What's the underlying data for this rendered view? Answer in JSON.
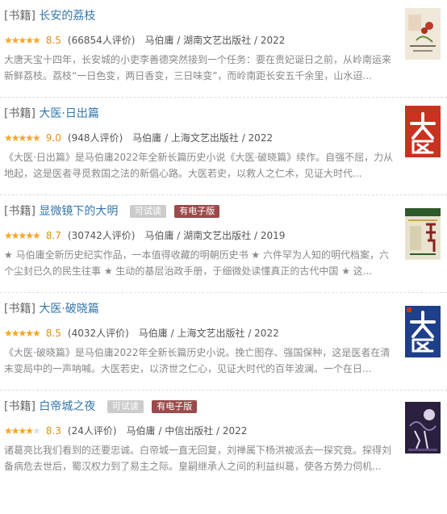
{
  "books": [
    {
      "category": "[书籍]",
      "title": "长安的荔枝",
      "tags": [],
      "score": "8.5",
      "rating_count": "(66854人评价)",
      "stars_filled": 4.5,
      "author": "马伯庸",
      "publisher": "湖南文艺出版社",
      "year": "2022",
      "description": "大唐天宝十四年，长安城的小吏李善德突然接到一个任务：要在贵妃诞日之前，从岭南运来新鲜荔枝。荔枝“一日色变，两日香变，三日味变”，而岭南距长安五千余里，山水迢..."
    },
    {
      "category": "[书籍]",
      "title": "大医·日出篇",
      "tags": [],
      "score": "9.0",
      "rating_count": "(948人评价)",
      "stars_filled": 4.5,
      "author": "马伯庸",
      "publisher": "上海文艺出版社",
      "year": "2022",
      "description": "《大医·日出篇》是马伯庸2022年全新长篇历史小说《大医·破晓篇》续作。自强不屈，力从地起，这是医者寻觅救国之法的新倡心路。大医若史，以救人之仁术，见证大时代..."
    },
    {
      "category": "[书籍]",
      "title": "显微镜下的大明",
      "tags": [
        "可试读",
        "有电子版"
      ],
      "score": "8.7",
      "rating_count": "(30742人评价)",
      "stars_filled": 4.5,
      "author": "马伯庸",
      "publisher": "湖南文艺出版社",
      "year": "2019",
      "description": "★ 马伯庸全新历史纪实作品，一本值得收藏的明朝历史书 ★ 六件罕为人知的明代档案，六个尘封已久的民生往事 ★ 生动的基层治政手册，于细微处读懂真正的古代中国 ★ 这..."
    },
    {
      "category": "[书籍]",
      "title": "大医·破晓篇",
      "tags": [],
      "score": "8.5",
      "rating_count": "(4032人评价)",
      "stars_filled": 4.5,
      "author": "马伯庸",
      "publisher": "上海文艺出版社",
      "year": "2022",
      "description": "《大医·破晓篇》是马伯庸2022年全新长篇历史小说。挽亡图存、强国保种，这是医者在清末变局中的一声呐喊。大医若史，以济世之仁心，见证大时代的百年波澜。一个在日..."
    },
    {
      "category": "[书籍]",
      "title": "白帝城之夜",
      "tags": [
        "可试读",
        "有电子版"
      ],
      "score": "8.3",
      "rating_count": "(24人评价)",
      "stars_filled": 4,
      "author": "马伯庸",
      "publisher": "中信出版社",
      "year": "2022",
      "description": "诸葛亮比我们看到的还要忠诚。白帝城一直无回复，刘禅属下杨洪被派去一探究竟。探得刘备病危去世后，蜀汉权力到了易主之际。皇嗣继承人之间的利益纠葛，使各方势力伺机..."
    }
  ],
  "covers": [
    {
      "icon": "cover-lychee",
      "colors": [
        "#f0e8d8",
        "#c0392b",
        "#6a8b3a"
      ]
    },
    {
      "icon": "cover-daiyi-sunrise",
      "colors": [
        "#c8321e",
        "#ffffff"
      ]
    },
    {
      "icon": "cover-microscope-ming",
      "colors": [
        "#2d5a2a",
        "#c9a845"
      ]
    },
    {
      "icon": "cover-daiyi-dawn",
      "colors": [
        "#1e3f8a",
        "#ffffff"
      ]
    },
    {
      "icon": "cover-baidi-night",
      "colors": [
        "#2a1f3d",
        "#d9d1e6"
      ]
    }
  ]
}
